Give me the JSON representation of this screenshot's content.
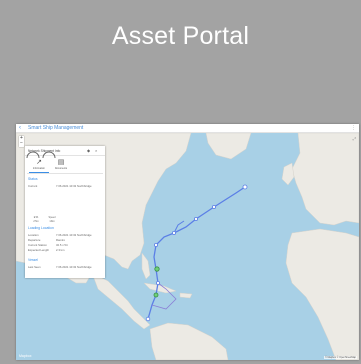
{
  "tile": {
    "title": "Asset Portal"
  },
  "screenshot": {
    "appbar": {
      "title": "Smart Ship Management",
      "back_icon": "arrow-left-icon",
      "menu_icon": "more-icon"
    },
    "panel": {
      "header": "Network Shipment Info",
      "tabs": [
        {
          "label": "Information",
          "icon": "chart-icon"
        },
        {
          "label": "Documents",
          "icon": "document-icon"
        }
      ],
      "sections": [
        {
          "title": "Status"
        },
        {
          "title": "Loading Location"
        },
        {
          "title": "Vessel"
        }
      ],
      "status_rows": [
        {
          "key": "Current",
          "value": "7.06.2021 10:32 Northbridge"
        }
      ],
      "gauge_labels": [
        "ETA",
        "Speed"
      ],
      "gauge_sub": [
        "27kn",
        "13kn"
      ],
      "location_rows": [
        {
          "key": "Location",
          "value": "7.06.2021 10:32 Northbridge"
        },
        {
          "key": "Departure",
          "value": "Ramiro"
        },
        {
          "key": "Current Station",
          "value": "32.5 x 54"
        },
        {
          "key": "Expected Length",
          "value": "2.3 km"
        }
      ],
      "vessel_rows": [
        {
          "key": "Last Seen",
          "value": "7.06.2021 10:32 Northbridge"
        }
      ]
    },
    "map": {
      "logo": "Mapbox",
      "attribution": "© Mapbox © OpenStreetMap"
    }
  },
  "colors": {
    "tile_bg": "#a3a3a3",
    "ocean": "#a8d0e6",
    "land": "#eceae4",
    "route": "#5b7fe6",
    "accent": "#3a8ee6"
  }
}
